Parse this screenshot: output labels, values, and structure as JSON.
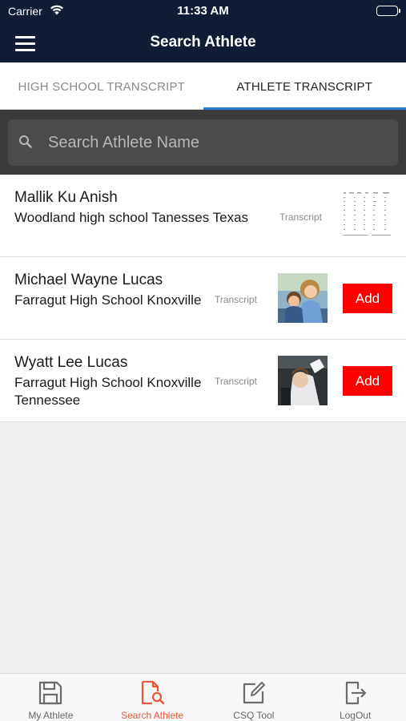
{
  "status_bar": {
    "carrier": "Carrier",
    "time": "11:33 AM"
  },
  "nav": {
    "title": "Search Athlete",
    "menu_icon": "hamburger-menu-icon"
  },
  "tabs": [
    {
      "label": "HIGH SCHOOL TRANSCRIPT",
      "active": false
    },
    {
      "label": "ATHLETE TRANSCRIPT",
      "active": true
    }
  ],
  "search": {
    "placeholder": "Search Athlete Name",
    "value": ""
  },
  "athletes": [
    {
      "name": "Mallik Ku Anish",
      "school": "Woodland high school Tanesses Texas",
      "transcript_label": "Transcript",
      "thumbnail": "transcript-document-thumbnail",
      "add_label": null
    },
    {
      "name": "Michael Wayne Lucas",
      "school": "Farragut High School Knoxville",
      "transcript_label": "Transcript",
      "thumbnail": "children-photo-thumbnail",
      "add_label": "Add"
    },
    {
      "name": "Wyatt Lee Lucas",
      "school": "Farragut High School Knoxville Tennessee",
      "transcript_label": "Transcript",
      "thumbnail": "athlete-photo-thumbnail",
      "add_label": "Add"
    }
  ],
  "bottom_tabs": [
    {
      "label": "My Athlete",
      "icon": "save-disk-icon",
      "active": false
    },
    {
      "label": "Search Athlete",
      "icon": "document-search-icon",
      "active": true
    },
    {
      "label": "CSQ Tool",
      "icon": "edit-pencil-icon",
      "active": false
    },
    {
      "label": "LogOut",
      "icon": "logout-icon",
      "active": false
    }
  ],
  "colors": {
    "header": "#101c34",
    "active_tab_underline": "#2a7fd3",
    "add_button": "#ff0000",
    "active_bottom_tab": "#e8553a"
  }
}
